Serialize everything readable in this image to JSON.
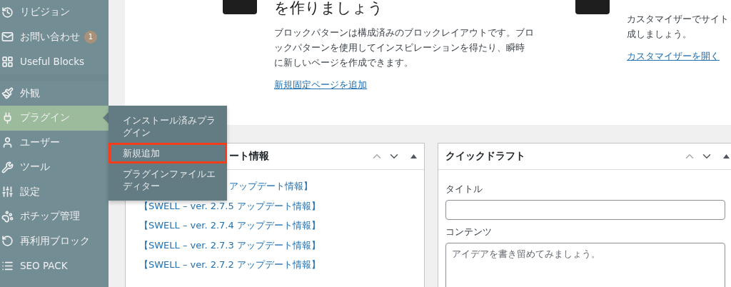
{
  "sidebar": {
    "items": [
      {
        "label": "リビジョン",
        "selected": false
      },
      {
        "label": "お問い合わせ",
        "selected": false,
        "badge": "1"
      },
      {
        "label": "Useful Blocks",
        "selected": false,
        "separator_after": true
      },
      {
        "label": "外観",
        "selected": false
      },
      {
        "label": "プラグイン",
        "selected": true
      },
      {
        "label": "ユーザー",
        "selected": false
      },
      {
        "label": "ツール",
        "selected": false
      },
      {
        "label": "設定",
        "selected": false
      },
      {
        "label": "ポチップ管理",
        "selected": false
      },
      {
        "label": "再利用ブロック",
        "selected": false
      },
      {
        "label": "SEO PACK",
        "selected": false
      }
    ]
  },
  "submenu": {
    "items": [
      {
        "label": "インストール済みプラグイン",
        "highlighted": false
      },
      {
        "label": "新規追加",
        "highlighted": true
      },
      {
        "label": "プラグインファイルエディター",
        "highlighted": false
      }
    ]
  },
  "welcome": {
    "columns": [
      {
        "heading": "を作りましょう",
        "description_lines": [
          "ブロックパターンは構成済みのブロックレイアウトです。ブロ",
          "ックパターンを使用してインスピレーションを得たり、瞬時",
          "に新しいページを作成できます。"
        ],
        "link": "新規固定ページを追加"
      },
      {
        "description_lines": [
          "カスタマイザーでサイト",
          "成しましょう。"
        ],
        "link": "カスタマイザーを開く"
      }
    ]
  },
  "updates_panel": {
    "title": "ート情報",
    "links": [
      "アップデート情報】",
      "【SWELL – ver. 2.7.5 アップデート情報】",
      "【SWELL – ver. 2.7.4 アップデート情報】",
      "【SWELL – ver. 2.7.3 アップデート情報】",
      "【SWELL – ver. 2.7.2 アップデート情報】"
    ]
  },
  "quick_draft": {
    "title": "クイックドラフト",
    "title_label": "タイトル",
    "content_label": "コンテンツ",
    "content_placeholder": "アイデアを書き留めてみましょう。"
  }
}
